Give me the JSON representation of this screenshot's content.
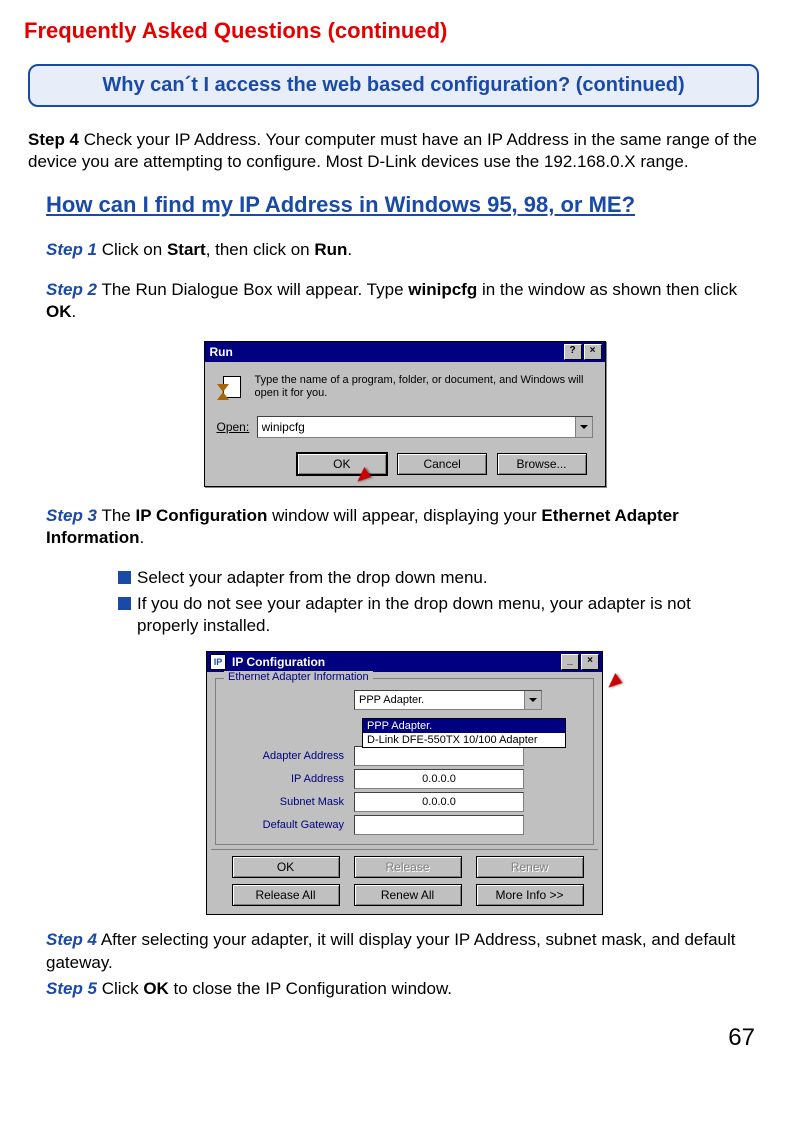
{
  "page_title": "Frequently Asked Questions (continued)",
  "question_box": "Why can´t I access the web based configuration? (continued)",
  "intro": {
    "step_label": "Step 4",
    "text": " Check your IP Address. Your computer must have an IP Address in the same range of the device you are attempting to configure. Most D-Link devices use the 192.168.0.X range."
  },
  "sub_heading": "How can I find my IP Address in Windows 95, 98, or ME?",
  "step1": {
    "label": "Step 1",
    "t1": " Click on ",
    "b1": "Start",
    "t2": ", then click on ",
    "b2": "Run",
    "t3": "."
  },
  "step2": {
    "label": "Step 2",
    "t1": " The Run Dialogue Box will appear. Type ",
    "b1": "winipcfg",
    "t2": " in the window as shown then click ",
    "b2": "OK",
    "t3": "."
  },
  "run_dialog": {
    "title": "Run",
    "hint": "Type the name of a program, folder, or document, and Windows will open it for you.",
    "open_label": "Open:",
    "open_value": "winipcfg",
    "btn_ok": "OK",
    "btn_cancel": "Cancel",
    "btn_browse": "Browse...",
    "help_btn": "?",
    "close_btn": "×"
  },
  "step3": {
    "label": "Step 3",
    "t1": " The ",
    "b1": "IP Configuration",
    "t2": " window will appear, displaying your ",
    "b2": "Ethernet Adapter Information",
    "t3": "."
  },
  "bullets": {
    "b1": "Select your adapter from the drop down menu.",
    "b2": "If you do not see your adapter in the drop down menu, your adapter is not properly installed."
  },
  "ipcfg": {
    "title": "IP Configuration",
    "group_legend": "Ethernet  Adapter Information",
    "adapter_selected": "PPP Adapter.",
    "options": {
      "o1": "PPP Adapter.",
      "o2": "D-Link DFE-550TX 10/100 Adapter"
    },
    "lbl_adapter_addr": "Adapter Address",
    "lbl_ip": "IP Address",
    "lbl_subnet": "Subnet Mask",
    "lbl_gw": "Default Gateway",
    "val_adapter_addr": "",
    "val_ip": "0.0.0.0",
    "val_subnet": "0.0.0.0",
    "val_gw": "",
    "btn_ok": "OK",
    "btn_release": "Release",
    "btn_renew": "Renew",
    "btn_release_all": "Release All",
    "btn_renew_all": "Renew All",
    "btn_more": "More Info >>",
    "min_btn": "_",
    "close_btn": "×"
  },
  "step4b": {
    "label": "Step 4",
    "text": "   After selecting your adapter, it will display your IP Address, subnet mask, and default gateway."
  },
  "step5": {
    "label": "Step 5",
    "t1": "  Click ",
    "b1": "OK",
    "t2": " to close the IP Configuration window."
  },
  "page_number": "67"
}
